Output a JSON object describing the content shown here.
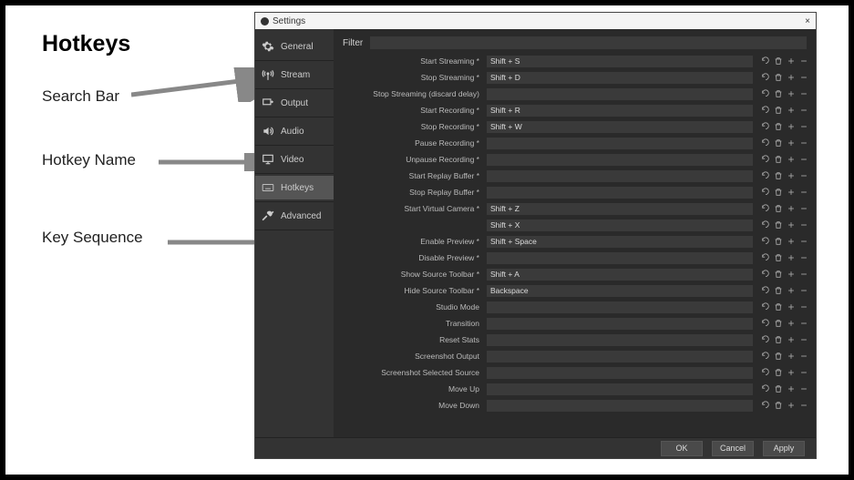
{
  "doc": {
    "title": "Hotkeys",
    "labels": [
      "Search Bar",
      "Hotkey Name",
      "Key Sequence"
    ]
  },
  "window": {
    "title": "Settings",
    "close": "×"
  },
  "sidebar": {
    "items": [
      {
        "icon": "gear-icon",
        "label": "General"
      },
      {
        "icon": "antenna-icon",
        "label": "Stream"
      },
      {
        "icon": "output-icon",
        "label": "Output"
      },
      {
        "icon": "speaker-icon",
        "label": "Audio"
      },
      {
        "icon": "monitor-icon",
        "label": "Video"
      },
      {
        "icon": "keyboard-icon",
        "label": "Hotkeys"
      },
      {
        "icon": "tools-icon",
        "label": "Advanced"
      }
    ],
    "selected_index": 5
  },
  "filter": {
    "label": "Filter",
    "placeholder": ""
  },
  "hotkeys": [
    {
      "name": "Start Streaming *",
      "value": "Shift + S"
    },
    {
      "name": "Stop Streaming *",
      "value": "Shift + D"
    },
    {
      "name": "Stop Streaming (discard delay)",
      "value": ""
    },
    {
      "name": "Start Recording *",
      "value": "Shift + R"
    },
    {
      "name": "Stop Recording *",
      "value": "Shift + W"
    },
    {
      "name": "Pause Recording *",
      "value": ""
    },
    {
      "name": "Unpause Recording *",
      "value": ""
    },
    {
      "name": "Start Replay Buffer *",
      "value": ""
    },
    {
      "name": "Stop Replay Buffer *",
      "value": ""
    },
    {
      "name": "Start Virtual Camera *",
      "value": "Shift + Z"
    },
    {
      "name": "",
      "value": "Shift + X"
    },
    {
      "name": "Enable Preview *",
      "value": "Shift + Space"
    },
    {
      "name": "Disable Preview *",
      "value": ""
    },
    {
      "name": "Show Source Toolbar *",
      "value": "Shift + A"
    },
    {
      "name": "Hide Source Toolbar *",
      "value": "Backspace"
    },
    {
      "name": "Studio Mode",
      "value": ""
    },
    {
      "name": "Transition",
      "value": ""
    },
    {
      "name": "Reset Stats",
      "value": ""
    },
    {
      "name": "Screenshot Output",
      "value": ""
    },
    {
      "name": "Screenshot Selected Source",
      "value": ""
    },
    {
      "name": "Move Up",
      "value": ""
    },
    {
      "name": "Move Down",
      "value": ""
    }
  ],
  "footer": {
    "ok": "OK",
    "cancel": "Cancel",
    "apply": "Apply"
  },
  "colors": {
    "bg": "#2a2a2a",
    "panel": "#333",
    "input": "#3a3a3a",
    "text": "#d0d0d0"
  }
}
